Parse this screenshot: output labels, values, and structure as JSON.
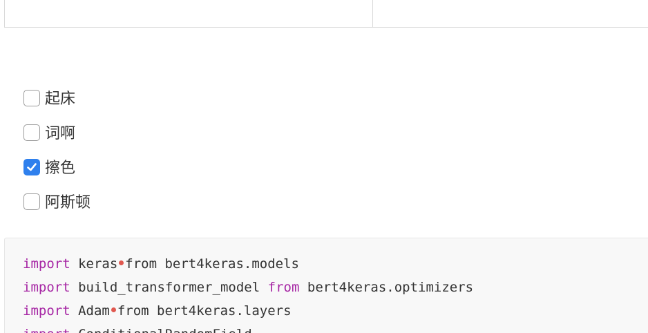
{
  "checklist": {
    "items": [
      {
        "label": "起床",
        "checked": false
      },
      {
        "label": "词啊",
        "checked": false
      },
      {
        "label": "擦色",
        "checked": true
      },
      {
        "label": "阿斯顿",
        "checked": false
      }
    ]
  },
  "code": {
    "lines": [
      {
        "kw1": "import",
        "t1": "keras",
        "kw2": "",
        "t2": "from bert4keras.models",
        "sep": true
      },
      {
        "kw1": "import",
        "t1": "build_transformer_model",
        "kw2": "from",
        "t2": "bert4keras.optimizers",
        "sep": false
      },
      {
        "kw1": "import",
        "t1": "Adam",
        "kw2": "",
        "t2": "from bert4keras.layers",
        "sep": true
      },
      {
        "kw1": "import",
        "t1": "ConditionalRandomField",
        "kw2": "",
        "t2": "",
        "sep": false
      }
    ]
  },
  "colors": {
    "keyword": "#a626a4",
    "separator": "#e0584f",
    "checkbox_checked": "#2f80ed",
    "code_bg": "#f8f8f8"
  }
}
